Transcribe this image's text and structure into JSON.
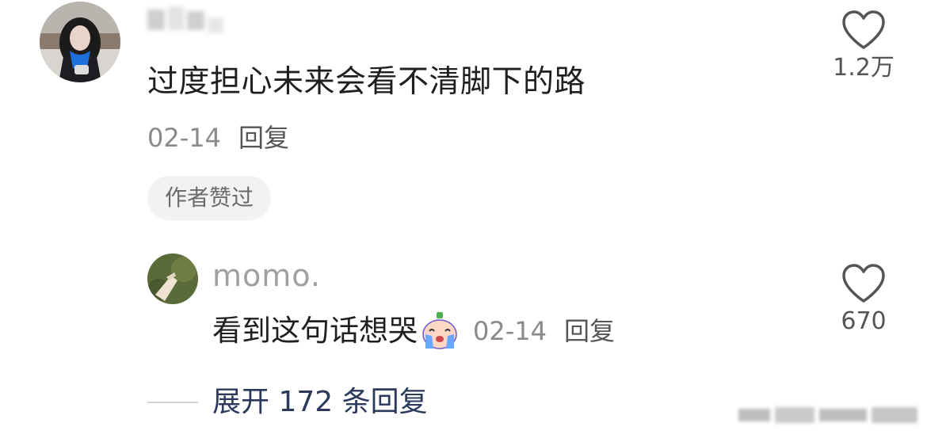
{
  "comment": {
    "avatar_icon": "user-avatar-icon",
    "text": "过度担心未来会看不清脚下的路",
    "date": "02-14",
    "reply_label": "回复",
    "badge": "作者赞过",
    "likes": "1.2万"
  },
  "reply": {
    "avatar_icon": "user-avatar-icon",
    "username": "momo.",
    "text": "看到这句话想哭",
    "emoji": "crying-face-icon",
    "date": "02-14",
    "reply_label": "回复",
    "likes": "670"
  },
  "expand": {
    "label": "展开 172 条回复"
  },
  "colors": {
    "text_primary": "#1f1f1f",
    "text_meta": "#8a8a8a",
    "expand_link": "#2b3a5b",
    "badge_bg": "#f2f2f2"
  }
}
